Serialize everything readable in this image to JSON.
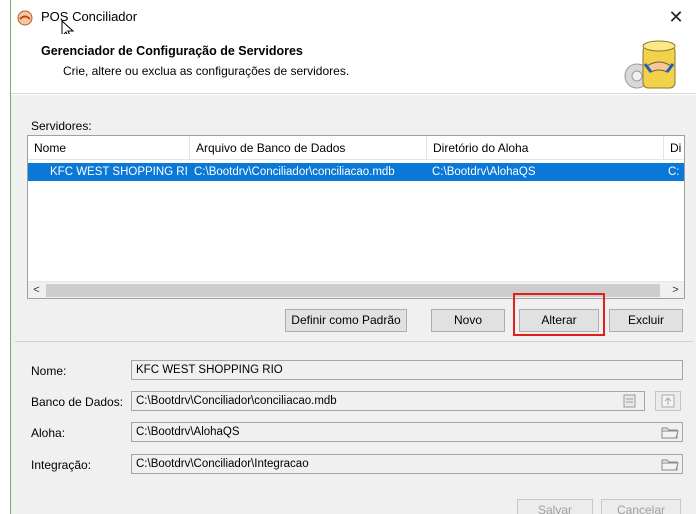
{
  "window": {
    "title": "POS Conciliador",
    "close_glyph": "✕"
  },
  "header": {
    "title": "Gerenciador de Configuração de Servidores",
    "subtitle": "Crie, altere ou exclua as configurações de servidores.",
    "art_icon": "server-handshake-icon"
  },
  "servers": {
    "label": "Servidores:",
    "columns": [
      "Nome",
      "Arquivo de Banco de Dados",
      "Diretório do Aloha",
      "Di"
    ],
    "rows": [
      [
        "KFC WEST SHOPPING RIO",
        "C:\\Bootdrv\\Conciliador\\conciliacao.mdb",
        "C:\\Bootdrv\\AlohaQS",
        "C:"
      ]
    ],
    "scroll_left": "<",
    "scroll_right": ">"
  },
  "buttons": {
    "set_default": "Definir como Padrão",
    "new": "Novo",
    "edit": "Alterar",
    "delete": "Excluir",
    "save": "Salvar",
    "cancel": "Cancelar"
  },
  "form": {
    "name_label": "Nome:",
    "name_value": "KFC WEST SHOPPING RIO",
    "db_label": "Banco de Dados:",
    "db_value": "C:\\Bootdrv\\Conciliador\\conciliacao.mdb",
    "aloha_label": "Aloha:",
    "aloha_value": "C:\\Bootdrv\\AlohaQS",
    "integration_label": "Integração:",
    "integration_value": "C:\\Bootdrv\\Conciliador\\Integracao"
  },
  "colors": {
    "selection": "#0a78d7",
    "highlight_box": "#e0201b"
  }
}
